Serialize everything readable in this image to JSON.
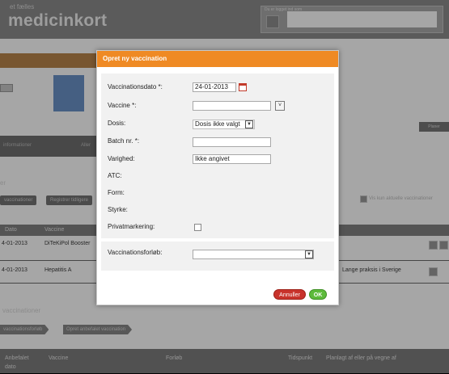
{
  "header": {
    "brand_sub": "et fælles",
    "brand": "medicinkort",
    "logged_in_label": "Du er logget ind som"
  },
  "background": {
    "tabs": [
      "informationer",
      "Aller"
    ],
    "register_btn": "Registrer tidligere",
    "prev_btn": "vaccinationer",
    "left_label": "er",
    "right_button": "Planer",
    "only_current_label": "Vis kun aktuelle vaccinationer",
    "table_headers": [
      "Dato",
      "Vaccine"
    ],
    "rows": [
      {
        "date": "4-01-2013",
        "vaccine": "DiTeKiPol Booster"
      },
      {
        "date": "4-01-2013",
        "vaccine": "Hepatitis A",
        "note": "Lange praksis i Sverige"
      }
    ],
    "section_title": "vaccinationer",
    "course_btn": "vaccinationsforløb",
    "recommended_btn": "Opret anbefalet vaccination",
    "bottom_headers": [
      "Anbefalet",
      "Vaccine",
      "Forløb",
      "Tidspunkt",
      "Planlagt af eller på vegne af"
    ],
    "bottom_headers_sub": "dato"
  },
  "dialog": {
    "title": "Opret ny vaccination",
    "fields": {
      "date_label": "Vaccinationsdato *:",
      "date_value": "24-01-2013",
      "vaccine_label": "Vaccine *:",
      "vaccine_value": "",
      "dose_label": "Dosis:",
      "dose_value": "Dosis ikke valgt",
      "batch_label": "Batch nr. *:",
      "batch_value": "",
      "duration_label": "Varighed:",
      "duration_value": "Ikke angivet",
      "atc_label": "ATC:",
      "form_label": "Form:",
      "strength_label": "Styrke:",
      "private_label": "Privatmarkering:",
      "course_label": "Vaccinationsforløb:",
      "course_value": ""
    },
    "cancel_label": "Annuller",
    "ok_label": "OK"
  },
  "icons": {
    "calendar": "calendar-icon",
    "dropdown": "chevron-down-icon"
  },
  "colors": {
    "accent": "#ef8a24",
    "cancel": "#c8332c",
    "ok": "#5dbb3b"
  }
}
